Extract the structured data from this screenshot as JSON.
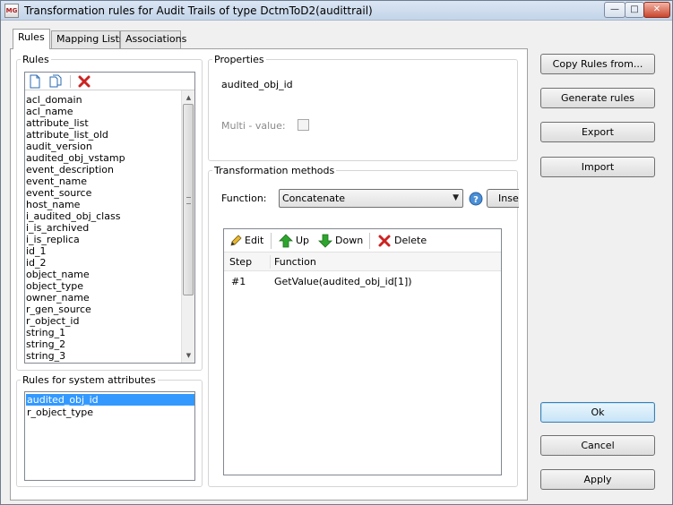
{
  "window": {
    "title": "Transformation rules for Audit Trails of type DctmToD2(audittrail)",
    "icon_text": "MG"
  },
  "tabs": [
    {
      "label": "Rules",
      "active": true
    },
    {
      "label": "Mapping Lists",
      "active": false
    },
    {
      "label": "Associations",
      "active": false
    }
  ],
  "rules_group": {
    "legend": "Rules",
    "items": [
      "acl_domain",
      "acl_name",
      "attribute_list",
      "attribute_list_old",
      "audit_version",
      "audited_obj_vstamp",
      "event_description",
      "event_name",
      "event_source",
      "host_name",
      "i_audited_obj_class",
      "i_is_archived",
      "i_is_replica",
      "id_1",
      "id_2",
      "object_name",
      "object_type",
      "owner_name",
      "r_gen_source",
      "r_object_id",
      "string_1",
      "string_2",
      "string_3"
    ]
  },
  "system_group": {
    "legend": "Rules for system attributes",
    "items": [
      {
        "label": "audited_obj_id",
        "selected": true
      },
      {
        "label": "r_object_type",
        "selected": false
      }
    ]
  },
  "properties": {
    "legend": "Properties",
    "attribute_name": "audited_obj_id",
    "multi_value_label": "Multi - value:",
    "multi_value_checked": false
  },
  "transformation": {
    "legend": "Transformation methods",
    "function_label": "Function:",
    "function_value": "Concatenate",
    "insert_label": "Inse",
    "toolbar": {
      "edit": "Edit",
      "up": "Up",
      "down": "Down",
      "delete": "Delete"
    },
    "columns": {
      "step": "Step",
      "function": "Function"
    },
    "rows": [
      {
        "step": "#1",
        "function": "GetValue(audited_obj_id[1])"
      }
    ]
  },
  "buttons": {
    "copy_rules": "Copy Rules from...",
    "generate_rules": "Generate rules",
    "export": "Export",
    "import": "Import",
    "ok": "Ok",
    "cancel": "Cancel",
    "apply": "Apply"
  },
  "colors": {
    "selection": "#3399ff",
    "up_arrow": "#2ea52e",
    "delete_x": "#cc2222"
  }
}
